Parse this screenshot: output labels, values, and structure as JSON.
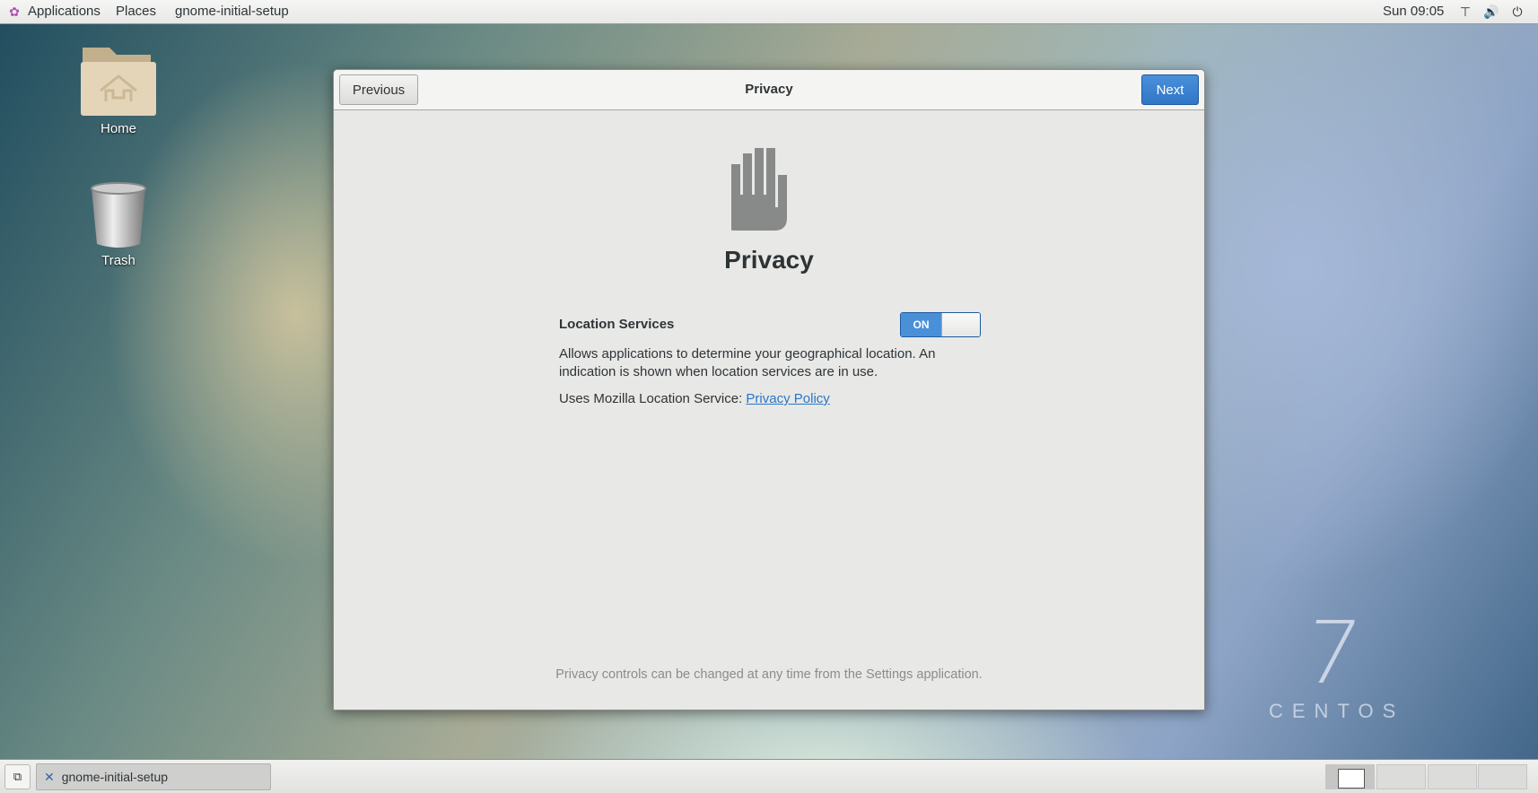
{
  "topbar": {
    "applications": "Applications",
    "places": "Places",
    "app": "gnome-initial-setup",
    "clock": "Sun 09:05"
  },
  "desktop": {
    "home": "Home",
    "trash": "Trash"
  },
  "dialog": {
    "previous": "Previous",
    "next": "Next",
    "title": "Privacy",
    "heading": "Privacy",
    "location_label": "Location Services",
    "toggle_state": "ON",
    "description": "Allows applications to determine your geographical location. An indication is shown when location services are in use.",
    "uses_text": "Uses Mozilla Location Service: ",
    "privacy_policy": "Privacy Policy",
    "footer": "Privacy controls can be changed at any time from the Settings application."
  },
  "branding": {
    "number": "7",
    "name": "CENTOS"
  },
  "taskbar": {
    "task": "gnome-initial-setup",
    "workspaces": 4,
    "active_workspace": 1
  },
  "colors": {
    "accent": "#4a90d9",
    "link": "#2a76c6"
  }
}
